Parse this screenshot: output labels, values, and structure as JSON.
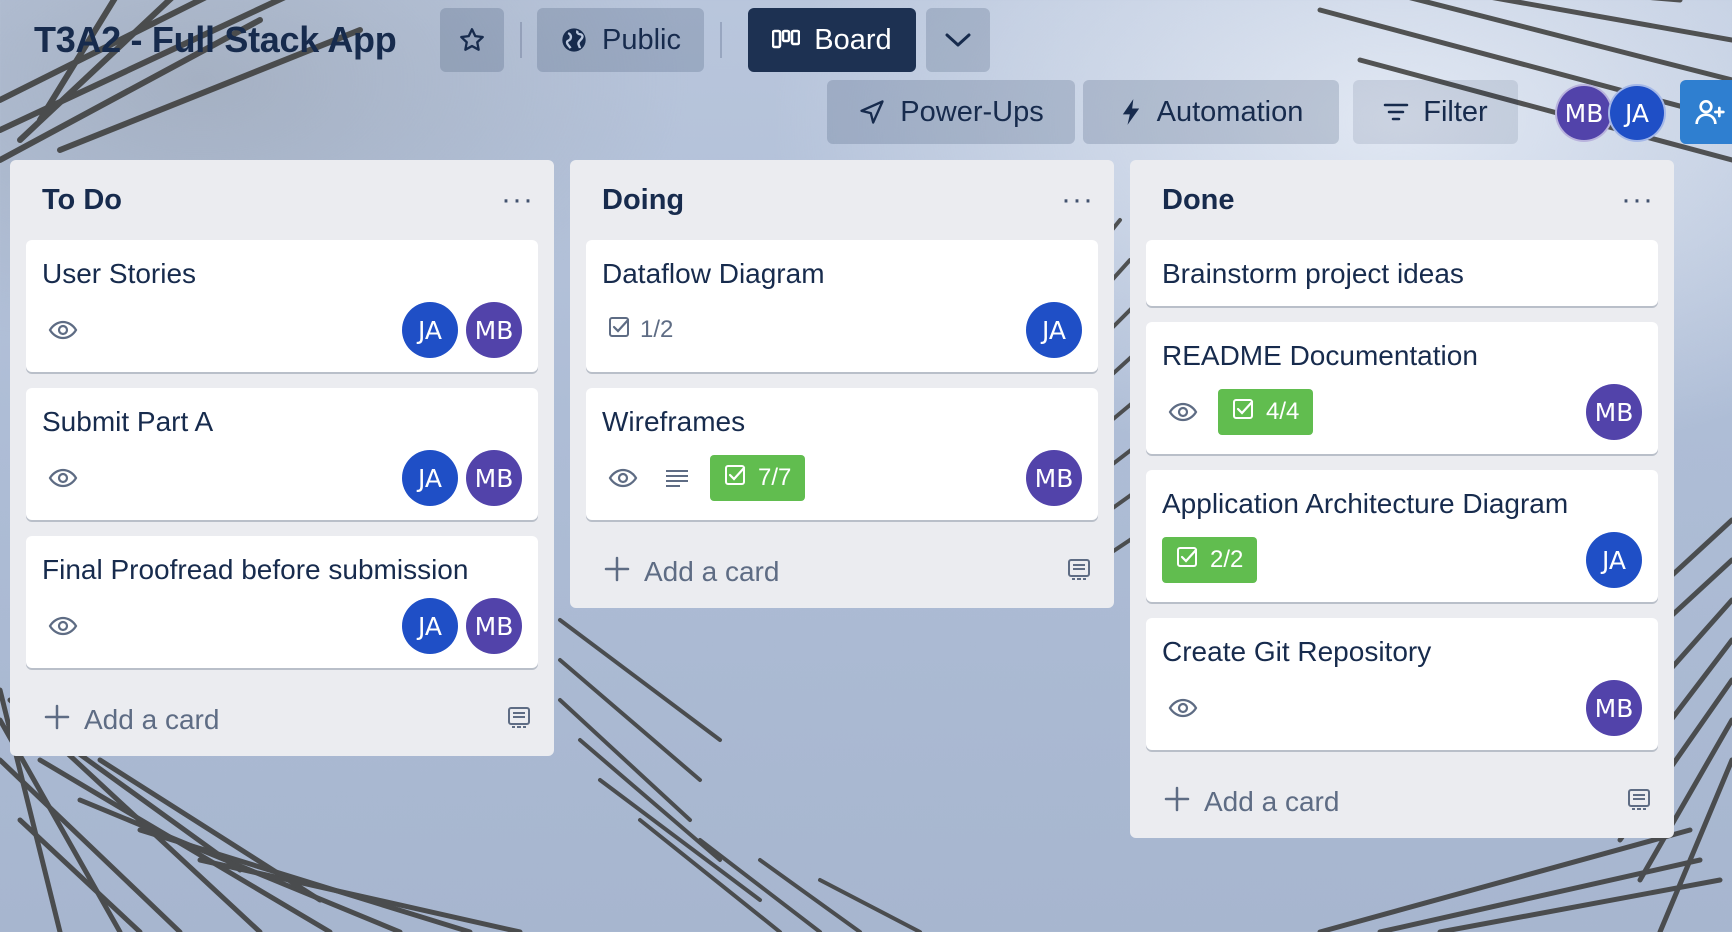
{
  "board": {
    "title": "T3A2 - Full Stack App",
    "visibility": "Public",
    "view": "Board",
    "powerups_label": "Power-Ups",
    "automation_label": "Automation",
    "filter_label": "Filter"
  },
  "members": [
    {
      "initials": "MB",
      "color": "#5243aa"
    },
    {
      "initials": "JA",
      "color": "#1f4fc6"
    }
  ],
  "colors": {
    "header_dark": "#1d3152",
    "checklist_complete": "#61bd4f",
    "list_bg": "#ebecf0",
    "member_ja": "#1f4fc6",
    "member_mb": "#5243aa",
    "share_button": "#2f7fd0"
  },
  "lists": [
    {
      "title": "To Do",
      "add_label": "Add a card",
      "cards": [
        {
          "title": "User Stories",
          "members": [
            "JA",
            "MB"
          ]
        },
        {
          "title": "Submit Part A",
          "members": [
            "JA",
            "MB"
          ]
        },
        {
          "title": "Final Proofread before submission",
          "members": [
            "JA",
            "MB"
          ]
        }
      ]
    },
    {
      "title": "Doing",
      "add_label": "Add a card",
      "cards": [
        {
          "title": "Dataflow Diagram",
          "checklist": "1/2",
          "members": [
            "JA"
          ]
        },
        {
          "title": "Wireframes",
          "checklist": "7/7",
          "members": [
            "MB"
          ]
        }
      ]
    },
    {
      "title": "Done",
      "add_label": "Add a card",
      "cards": [
        {
          "title": "Brainstorm project ideas"
        },
        {
          "title": "README Documentation",
          "checklist": "4/4",
          "members": [
            "MB"
          ]
        },
        {
          "title": "Application Architecture Diagram",
          "checklist": "2/2",
          "members": [
            "JA"
          ]
        },
        {
          "title": "Create Git Repository",
          "members": [
            "MB"
          ]
        }
      ]
    }
  ],
  "icons": {
    "watch": "eye-icon",
    "description": "description-icon",
    "checklist": "checklist-icon",
    "template": "card-template-icon",
    "add": "plus-icon",
    "star": "star-icon",
    "public": "globe-icon",
    "board": "board-icon",
    "powerups": "rocket-icon",
    "automation": "lightning-icon",
    "filter": "filter-icon",
    "share": "add-member-icon"
  }
}
